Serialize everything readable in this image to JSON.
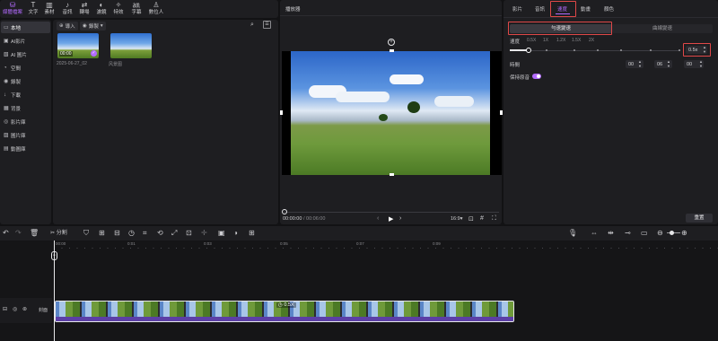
{
  "toolbar": {
    "items": [
      {
        "label": "媒體檔案",
        "icon": "media-icon",
        "glyph": "⛁",
        "active": true
      },
      {
        "label": "文字",
        "icon": "text-icon",
        "glyph": "T",
        "active": false
      },
      {
        "label": "素材",
        "icon": "assets-icon",
        "glyph": "▥",
        "active": false
      },
      {
        "label": "音訊",
        "icon": "audio-icon",
        "glyph": "♪",
        "active": false
      },
      {
        "label": "轉場",
        "icon": "transition-icon",
        "glyph": "⇄",
        "active": false
      },
      {
        "label": "濾鏡",
        "icon": "filter-icon",
        "glyph": "◐",
        "active": false
      },
      {
        "label": "特效",
        "icon": "effects-icon",
        "glyph": "✧",
        "active": false
      },
      {
        "label": "字幕",
        "icon": "captions-icon",
        "glyph": "㏂",
        "active": false
      },
      {
        "label": "數位人",
        "icon": "avatar-icon",
        "glyph": "♙",
        "active": false
      }
    ]
  },
  "leftnav": {
    "items": [
      {
        "label": "本地",
        "icon": "folder-icon",
        "glyph": "▭",
        "active": true
      },
      {
        "label": "AI影片",
        "icon": "ai-video-icon",
        "glyph": "▣",
        "active": false
      },
      {
        "label": "AI 圖片",
        "icon": "ai-image-icon",
        "glyph": "▧",
        "active": false
      },
      {
        "label": "空間",
        "icon": "space-icon",
        "glyph": "◔",
        "active": false
      },
      {
        "label": "錄製",
        "icon": "record-icon",
        "glyph": "◉",
        "active": false
      },
      {
        "label": "下載",
        "icon": "download-icon",
        "glyph": "↓",
        "active": false
      },
      {
        "label": "背景",
        "icon": "background-icon",
        "glyph": "▦",
        "active": false
      },
      {
        "label": "影片庫",
        "icon": "video-library-icon",
        "glyph": "◎",
        "active": false
      },
      {
        "label": "圖片庫",
        "icon": "image-library-icon",
        "glyph": "▨",
        "active": false
      },
      {
        "label": "動圖庫",
        "icon": "gif-library-icon",
        "glyph": "▤",
        "active": false
      }
    ]
  },
  "media": {
    "import_label": "導入",
    "record_label": "錄製",
    "clips": [
      {
        "name": "2025-06-27_02",
        "duration": "00:00"
      },
      {
        "name": "风景图",
        "duration": ""
      }
    ]
  },
  "player": {
    "title": "播放器",
    "time_current": "00:00:00",
    "time_separator": " / ",
    "time_total": "00:06:00",
    "aspect": "16:9",
    "aspect_caret": "▾"
  },
  "props": {
    "tabs": [
      {
        "label": "影片",
        "active": false
      },
      {
        "label": "音訊",
        "active": false
      },
      {
        "label": "速度",
        "active": true
      },
      {
        "label": "動畫",
        "active": false
      },
      {
        "label": "顏色",
        "active": false
      }
    ],
    "mode_uniform": "勻速變速",
    "mode_curve": "曲線變速",
    "speed_label": "速度",
    "speed_marks": [
      "0.5X",
      "1X",
      "1.2X",
      "1.5X",
      "2X"
    ],
    "speed_value": "0.5x",
    "speed_slider_value": 0.5,
    "time_label": "時間",
    "time_fields": [
      "00",
      "06",
      "00"
    ],
    "keep_pitch_label": "保持原音",
    "keep_pitch_on": true,
    "reset_label": "重置"
  },
  "timeline": {
    "split_label": "分割",
    "ruler": [
      "00:00",
      "0:01",
      "0:03",
      "0:05",
      "0:07",
      "0:09"
    ],
    "cover_label": "封面",
    "clip_speed_label": "0.5X",
    "colors": {
      "accent": "#b36bff",
      "clip": "#5c3fa6",
      "highlight": "#e04848"
    }
  }
}
